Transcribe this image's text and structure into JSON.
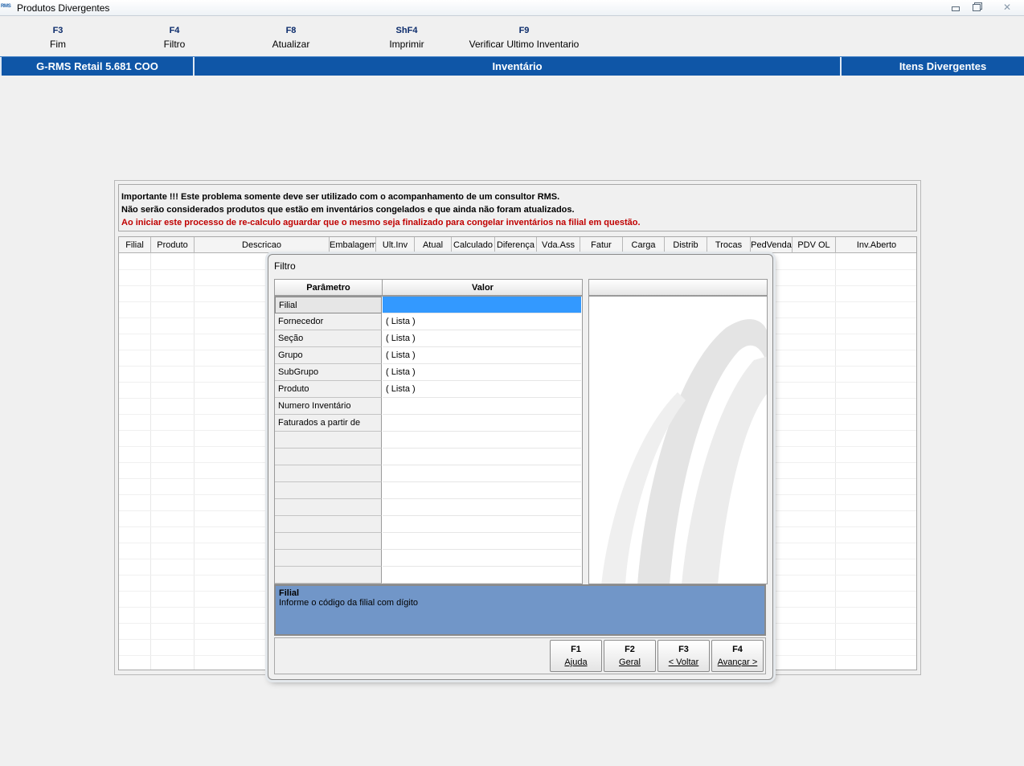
{
  "window": {
    "logo": "RMS",
    "title": "Produtos Divergentes"
  },
  "fkeys": [
    {
      "key": "F3",
      "label": "Fim"
    },
    {
      "key": "F4",
      "label": "Filtro"
    },
    {
      "key": "F8",
      "label": "Atualizar"
    },
    {
      "key": "ShF4",
      "label": "Imprimir"
    },
    {
      "key": "F9",
      "label": "Verificar Ultimo Inventario"
    }
  ],
  "banner": {
    "app": "G-RMS Retail 5.681 COO",
    "module": "Inventário",
    "screen": "Itens Divergentes"
  },
  "notice": {
    "line1": "Importante !!! Este problema somente deve ser utilizado com o acompanhamento de um consultor RMS.",
    "line2": "Não serão considerados produtos que estão em inventários congelados e que ainda não foram atualizados.",
    "line3": "Ao iniciar este processo de re-calculo aguardar que o mesmo seja finalizado para congelar inventários na filial em questão."
  },
  "grid_columns": [
    "Filial",
    "Produto",
    "Descricao",
    "Embalagem",
    "Ult.Inv",
    "Atual",
    "Calculado",
    "Diferença",
    "Vda.Ass",
    "Fatur",
    "Carga",
    "Distrib",
    "Trocas",
    "PedVenda",
    "PDV OL",
    "Inv.Aberto"
  ],
  "dialog": {
    "title": "Filtro",
    "col_param": "Parâmetro",
    "col_value": "Valor",
    "params": [
      {
        "name": "Filial",
        "value": ""
      },
      {
        "name": "Fornecedor",
        "value": "( Lista )"
      },
      {
        "name": "Seção",
        "value": "( Lista )"
      },
      {
        "name": "Grupo",
        "value": "( Lista )"
      },
      {
        "name": "SubGrupo",
        "value": "( Lista )"
      },
      {
        "name": "Produto",
        "value": "( Lista )"
      },
      {
        "name": "Numero Inventário",
        "value": ""
      },
      {
        "name": "Faturados a partir de",
        "value": ""
      }
    ],
    "help_title": "Filial",
    "help_text": "Informe o código da filial com dígito",
    "buttons": [
      {
        "key": "F1",
        "label": "Ajuda"
      },
      {
        "key": "F2",
        "label": "Geral"
      },
      {
        "key": "F3",
        "label": "< Voltar"
      },
      {
        "key": "F4",
        "label": "Avançar >"
      }
    ]
  },
  "colors": {
    "banner_blue": "#0f56a7",
    "selection_blue": "#3399ff",
    "help_blue": "#7196c8",
    "notice_red": "#c00000"
  }
}
